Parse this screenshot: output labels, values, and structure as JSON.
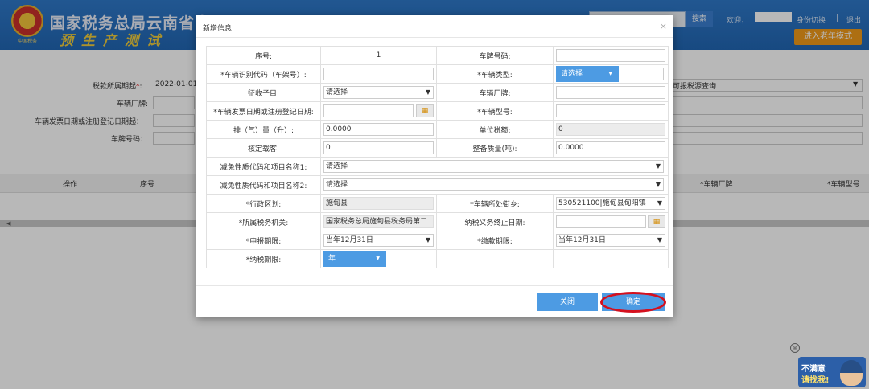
{
  "header": {
    "site_title": "国家税务总局云南省电",
    "env_label": "预生产测试",
    "emblem_text": "中国税务",
    "search_button": "搜索",
    "welcome": "欢迎，",
    "identity_switch": "身份切换",
    "separator": "|",
    "logout": "退出",
    "old_mode_button": "进入老年模式"
  },
  "background": {
    "tax_period_label": "税款所属期起",
    "tax_period_value": "2022-01-01",
    "brand_label": "车辆厂牌:",
    "invoice_date_label": "车辆发票日期或注册登记日期起：",
    "plate_label": "车牌号码：",
    "reportable_query": "可报税源查询",
    "grid_columns": [
      "操作",
      "序号",
      "*车辆厂牌",
      "*车辆型号"
    ]
  },
  "modal": {
    "title": "新增信息",
    "close_icon": "×",
    "rows": {
      "seq_label": "序号:",
      "seq_value": "1",
      "plate_label": "车牌号码:",
      "vin_label": "*车辆识别代码（车架号）:",
      "vehicle_type_label": "*车辆类型:",
      "vehicle_type_value": "请选择",
      "sub_item_label": "征收子目:",
      "sub_item_value": "请选择",
      "brand_label": "车辆厂牌:",
      "invoice_date_label": "*车辆发票日期或注册登记日期:",
      "model_label": "*车辆型号:",
      "displacement_label": "排（气）量（升）:",
      "displacement_value": "0.0000",
      "unit_tax_label": "单位税额:",
      "unit_tax_value": "0",
      "passengers_label": "核定载客:",
      "passengers_value": "0",
      "curb_mass_label": "整备质量(吨):",
      "curb_mass_value": "0.0000",
      "exemption1_label": "减免性质代码和项目名称1:",
      "exemption1_value": "请选择",
      "exemption2_label": "减免性质代码和项目名称2:",
      "exemption2_value": "请选择",
      "district_label": "*行政区划:",
      "district_value": "施甸县",
      "street_label": "*车辆所处街乡:",
      "street_value": "530521100|施甸县甸阳镇",
      "tax_authority_label": "*所属税务机关:",
      "tax_authority_value": "国家税务总局施甸县税务局第二",
      "obligation_end_label": "纳税义务终止日期:",
      "filing_deadline_label": "*申报期限:",
      "filing_deadline_value": "当年12月31日",
      "payment_deadline_label": "*缴款期限:",
      "payment_deadline_value": "当年12月31日",
      "tax_period_label": "*纳税期限:",
      "tax_period_value": "年"
    },
    "close_button": "关闭",
    "confirm_button": "确定"
  },
  "widget": {
    "close_icon": "⊗",
    "line1": "不满意",
    "line2": "请找我!"
  },
  "colors": {
    "header_blue": "#2166b3",
    "primary_button": "#4d9be3",
    "highlight_ring": "#d4101e",
    "old_mode_orange": "#f09a1a"
  }
}
